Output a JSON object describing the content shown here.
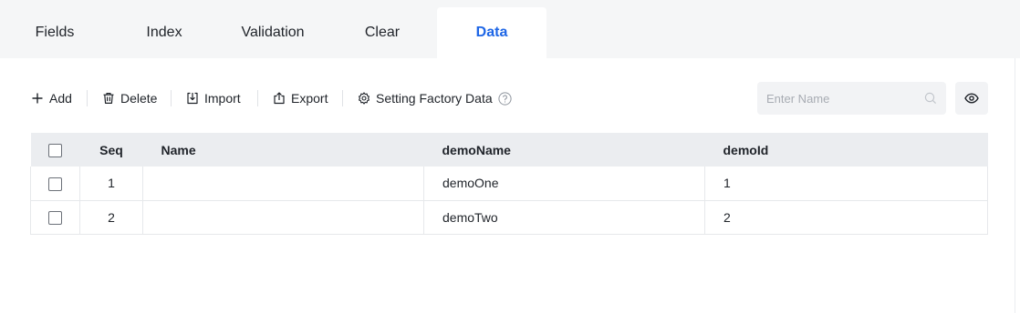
{
  "tabs": [
    {
      "label": "Fields"
    },
    {
      "label": "Index"
    },
    {
      "label": "Validation"
    },
    {
      "label": "Clear"
    },
    {
      "label": "Data",
      "active": true
    }
  ],
  "toolbar": {
    "add_label": "Add",
    "delete_label": "Delete",
    "import_label": "Import",
    "export_label": "Export",
    "setting_label": "Setting Factory Data"
  },
  "search": {
    "placeholder": "Enter Name",
    "value": ""
  },
  "table": {
    "columns": [
      "Seq",
      "Name",
      "demoName",
      "demoId"
    ],
    "rows": [
      {
        "seq": "1",
        "name": "",
        "demoName": "demoOne",
        "demoId": "1"
      },
      {
        "seq": "2",
        "name": "",
        "demoName": "demoTwo",
        "demoId": "2"
      }
    ]
  },
  "colors": {
    "accent": "#1e66e6",
    "tabbar_bg": "#f5f6f7",
    "header_bg": "#ebedf0"
  }
}
